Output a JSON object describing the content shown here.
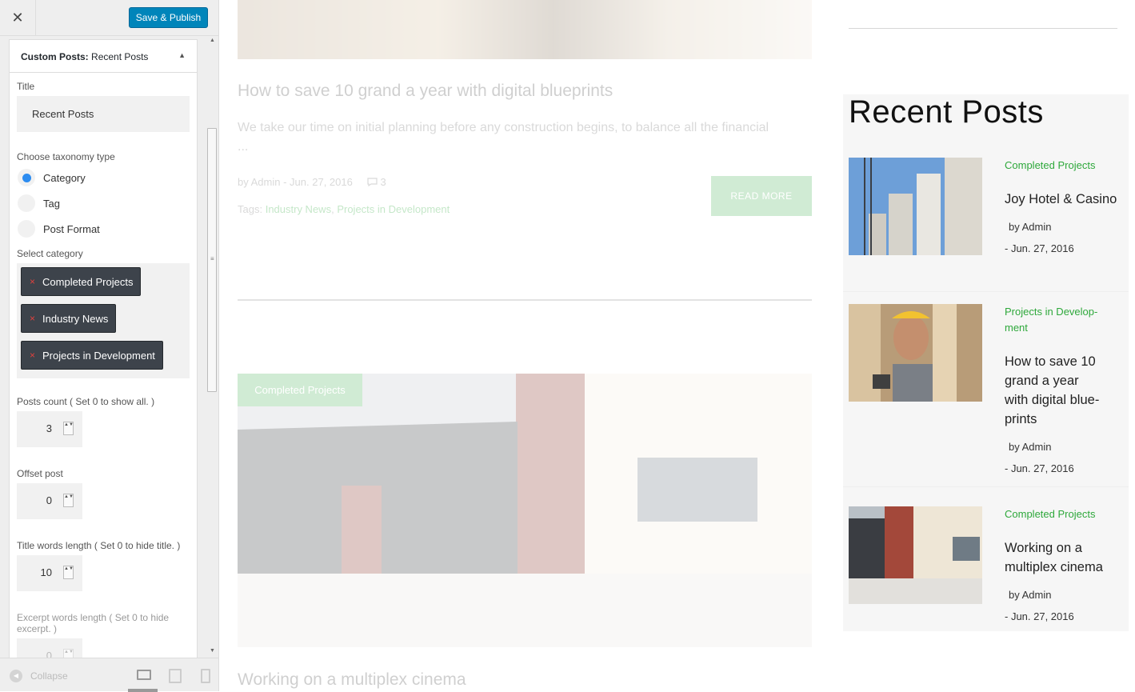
{
  "customizer": {
    "close_label": "✕",
    "publish_label": "Save & Publish",
    "panel": {
      "title_prefix": "Custom Posts:",
      "title_name": "Recent Posts",
      "toggle_icon": "▲",
      "title_label": "Title",
      "title_value": "Recent Posts",
      "taxonomy_label": "Choose taxonomy type",
      "taxonomy_options": [
        "Category",
        "Tag",
        "Post Format"
      ],
      "taxonomy_selected": "Category",
      "category_label": "Select category",
      "categories": [
        "Completed Projects",
        "Industry News",
        "Projects in Development"
      ],
      "chip_remove": "×",
      "posts_count_label": "Posts count ( Set 0 to show all. )",
      "posts_count": "3",
      "offset_label": "Offset post",
      "offset": "0",
      "title_words_label": "Title words length ( Set 0 to hide title. )",
      "title_words": "10",
      "excerpt_words_label": "Excerpt words length ( Set 0 to hide excerpt. )",
      "excerpt_words": "0",
      "spinner_glyph": "▲▼"
    },
    "scroll_up": "▲",
    "scroll_down": "▼",
    "scroll_grip": "≡",
    "collapse_icon": "◀",
    "collapse_label": "Collapse"
  },
  "preview": {
    "post1": {
      "title": "How to save 10 grand a year with digital blueprints",
      "excerpt": "We take our time on initial planning before any construction begins, to balance all the financial",
      "excerpt_more": "...",
      "meta_author": "by Admin",
      "meta_date": "- Jun. 27, 2016",
      "comment_count": "3",
      "tags_label": "Tags:",
      "tag1": "Industry News",
      "tag_sep": ",",
      "tag2": "Projects in Development",
      "read_more": "READ MORE"
    },
    "post2": {
      "category": "Completed Projects",
      "title": "Working on a multiplex cinema"
    },
    "widget": {
      "title": "Recent Posts",
      "posts": [
        {
          "category": "Completed Projects",
          "title": "Joy Hotel & Casino",
          "author": "by Admin",
          "date": "- Jun. 27, 2016"
        },
        {
          "category": "Projects in Develop- ment",
          "title": "How to save 10 grand a year with digital blue- prints",
          "author": "by Admin",
          "date": "- Jun. 27, 2016"
        },
        {
          "category": "Completed Projects",
          "title": "Working on a multiplex cinema",
          "author": "by Admin",
          "date": "- Jun. 27, 2016"
        }
      ]
    }
  },
  "colors": {
    "publish_blue": "#0085ba",
    "accent_green": "#2ea83b",
    "chip_dark": "#3d434b",
    "radio_selected": "#2d8cf0"
  }
}
